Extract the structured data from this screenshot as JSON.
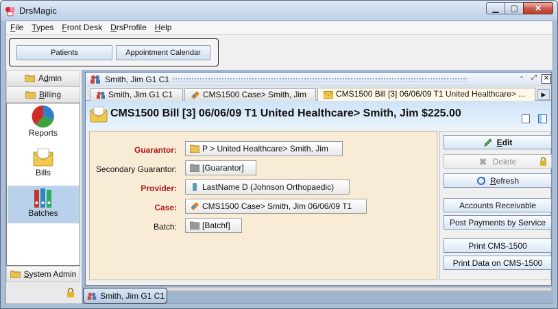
{
  "window": {
    "title": "DrsMagic"
  },
  "menu": [
    {
      "pre": "",
      "u": "F",
      "post": "ile"
    },
    {
      "pre": "",
      "u": "T",
      "post": "ypes"
    },
    {
      "pre": "",
      "u": "F",
      "post": "ront Desk"
    },
    {
      "pre": "",
      "u": "D",
      "post": "rsProfile"
    },
    {
      "pre": "",
      "u": "H",
      "post": "elp"
    }
  ],
  "toolbar": {
    "patients": "Patients",
    "calendar": "Appointment Calendar"
  },
  "sidebar": {
    "admin": {
      "pre": "A",
      "u": "d",
      "post": "min"
    },
    "billing": {
      "pre": "",
      "u": "B",
      "post": "illing"
    },
    "items": [
      "Reports",
      "Bills",
      "Batches"
    ],
    "system_admin": {
      "pre": "",
      "u": "S",
      "post": "ystem Admin"
    }
  },
  "inner_title": "Smith, Jim G1 C1",
  "tabs": [
    "Smith, Jim G1 C1",
    "CMS1500 Case> Smith, Jim",
    "CMS1500 Bill [3] 06/06/09 T1 United Healthcare> ..."
  ],
  "banner_title": "CMS1500 Bill [3] 06/06/09 T1 United Healthcare> Smith, Jim $225.00",
  "form": {
    "guarantor_label": "Guarantor:",
    "guarantor_value": "P > United Healthcare> Smith, Jim",
    "secondary_label": "Secondary Guarantor:",
    "secondary_value": "[Guarantor]",
    "provider_label": "Provider:",
    "provider_value": "LastName D (Johnson Orthopaedic)",
    "case_label": "Case:",
    "case_value": "CMS1500 Case> Smith, Jim 06/06/09 T1",
    "batch_label": "Batch:",
    "batch_value": "[Batchf]"
  },
  "actions": {
    "edit": {
      "pre": "",
      "u": "E",
      "post": "dit"
    },
    "delete": "Delete",
    "refresh": {
      "pre": "",
      "u": "R",
      "post": "efresh"
    },
    "ar": "Accounts Receivable",
    "post_payments": "Post Payments by Service",
    "print_cms": "Print CMS-1500",
    "print_data": "Print Data on CMS-1500"
  },
  "window_tab": "Smith, Jim G1 C1",
  "colors": {
    "required_label": "#b21818",
    "form_bg": "#f8ecd6",
    "banner": "#cfe3f7"
  }
}
